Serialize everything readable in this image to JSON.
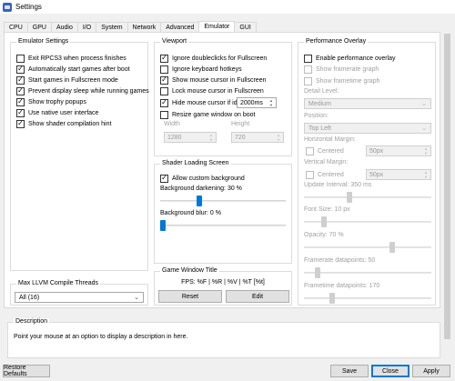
{
  "window": {
    "title": "Settings"
  },
  "tabs": [
    {
      "label": "CPU"
    },
    {
      "label": "GPU"
    },
    {
      "label": "Audio"
    },
    {
      "label": "I/O"
    },
    {
      "label": "System"
    },
    {
      "label": "Network"
    },
    {
      "label": "Advanced"
    },
    {
      "label": "Emulator",
      "active": true
    },
    {
      "label": "GUI"
    }
  ],
  "emulator_settings": {
    "title": "Emulator Settings",
    "options": [
      {
        "label": "Exit RPCS3 when process finishes",
        "checked": false
      },
      {
        "label": "Automatically start games after boot",
        "checked": true
      },
      {
        "label": "Start games in Fullscreen mode",
        "checked": true
      },
      {
        "label": "Prevent display sleep while running games",
        "checked": true
      },
      {
        "label": "Show trophy popups",
        "checked": true
      },
      {
        "label": "Use native user interface",
        "checked": true
      },
      {
        "label": "Show shader compilation hint",
        "checked": true
      }
    ]
  },
  "llvm_threads": {
    "title": "Max LLVM Compile Threads",
    "selected": "All (16)"
  },
  "viewport": {
    "title": "Viewport",
    "options": [
      {
        "label": "Ignore doubleclicks for Fullscreen",
        "checked": true
      },
      {
        "label": "Ignore keyboard hotkeys",
        "checked": false
      },
      {
        "label": "Show mouse cursor in Fullscreen",
        "checked": true
      },
      {
        "label": "Lock mouse cursor in Fullscreen",
        "checked": false
      },
      {
        "label": "Hide mouse cursor if idle",
        "checked": true
      }
    ],
    "idle_value": "2000ms",
    "resize_label": "Resize game window on boot",
    "resize_checked": false,
    "width_label": "Width",
    "height_label": "Height",
    "width_value": "1280",
    "height_value": "720"
  },
  "shader_loading": {
    "title": "Shader Loading Screen",
    "custom_bg_label": "Allow custom background",
    "custom_bg_checked": true,
    "darkening_label": "Background darkening: 30 %",
    "darkening_value": 30,
    "blur_label": "Background blur: 0 %",
    "blur_value": 0
  },
  "game_window_title": {
    "title": "Game Window Title",
    "format": "FPS: %F | %R | %V | %T [%t]",
    "reset_label": "Reset",
    "edit_label": "Edit"
  },
  "performance_overlay": {
    "title": "Performance Overlay",
    "enable_label": "Enable performance overlay",
    "enable_checked": false,
    "show_framerate_graph": "Show framerate graph",
    "show_frametime_graph": "Show frametime graph",
    "detail_level_label": "Detail Level:",
    "detail_level_value": "Medium",
    "position_label": "Position:",
    "position_value": "Top Left",
    "h_margin_label": "Horizontal Margin:",
    "h_centered_label": "Centered",
    "h_margin_value": "50px",
    "v_margin_label": "Vertical Margin:",
    "v_centered_label": "Centered",
    "v_margin_value": "50px",
    "update_interval_label": "Update Interval: 350 ms",
    "update_interval_fraction": 0.35,
    "font_size_label": "Font Size: 10 px",
    "font_size_fraction": 0.14,
    "opacity_label": "Opacity: 70 %",
    "opacity_fraction": 0.7,
    "framerate_points_label": "Framerate datapoints: 50",
    "framerate_points_fraction": 0.09,
    "frametime_points_label": "Frametime datapoints: 170",
    "frametime_points_fraction": 0.21
  },
  "description": {
    "title": "Description",
    "text": "Point your mouse at an option to display a description in here."
  },
  "buttons": {
    "restore_defaults": "Restore Defaults",
    "save": "Save",
    "close": "Close",
    "apply": "Apply"
  }
}
